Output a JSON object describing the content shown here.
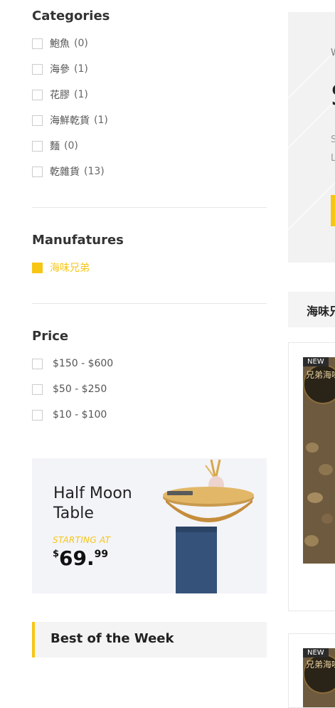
{
  "filters": {
    "categories": {
      "title": "Categories",
      "items": [
        {
          "label": "鮑魚",
          "count": "(0)"
        },
        {
          "label": "海參",
          "count": "(1)"
        },
        {
          "label": "花膠",
          "count": "(1)"
        },
        {
          "label": "海鮮乾貨",
          "count": "(1)"
        },
        {
          "label": "麵",
          "count": "(0)"
        },
        {
          "label": "乾雜貨",
          "count": "(13)"
        }
      ]
    },
    "manufacturers": {
      "title": "Manufatures",
      "items": [
        {
          "label": "海味兄弟",
          "checked": true
        }
      ]
    },
    "price": {
      "title": "Price",
      "items": [
        {
          "label": "$150 - $600"
        },
        {
          "label": "$50 - $250"
        },
        {
          "label": "$10 - $100"
        }
      ]
    }
  },
  "promo": {
    "title": "Half Moon Table",
    "starting_label": "STARTING AT",
    "currency": "$",
    "price_int": "69.",
    "price_dec": "99"
  },
  "best_of_week": {
    "title": "Best of the Week"
  },
  "banner": {
    "line1": "W",
    "big": "S",
    "line2": "S",
    "line3": "L"
  },
  "shop": {
    "title": "海味兄",
    "products": [
      {
        "badge": "NEW",
        "seal_text": "兄弟海味"
      },
      {
        "badge": "NEW",
        "seal_text": "兄弟海味"
      }
    ]
  },
  "colors": {
    "accent": "#f7c514",
    "panel": "#f3f4f8",
    "divider": "#e6e6e6"
  }
}
